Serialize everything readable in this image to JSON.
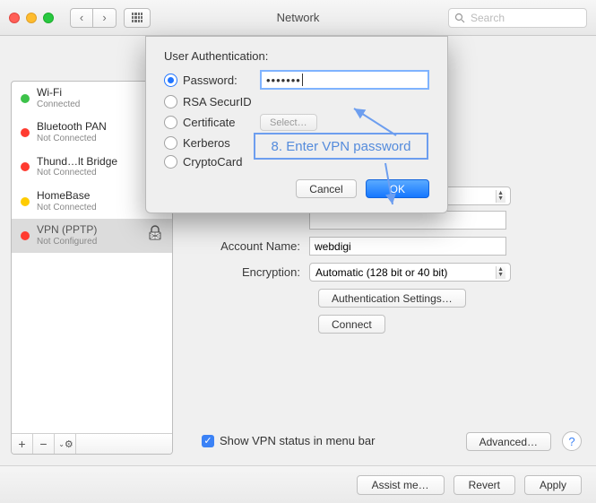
{
  "window": {
    "title": "Network",
    "search_placeholder": "Search"
  },
  "sidebar": {
    "items": [
      {
        "name": "Wi-Fi",
        "status": "Connected",
        "dot": "green"
      },
      {
        "name": "Bluetooth PAN",
        "status": "Not Connected",
        "dot": "red"
      },
      {
        "name": "Thund…lt Bridge",
        "status": "Not Connected",
        "dot": "red"
      },
      {
        "name": "HomeBase",
        "status": "Not Connected",
        "dot": "orange"
      },
      {
        "name": "VPN (PPTP)",
        "status": "Not Configured",
        "dot": "red"
      }
    ]
  },
  "form": {
    "account_name_label": "Account Name:",
    "account_name_value": "webdigi",
    "encryption_label": "Encryption:",
    "encryption_value": "Automatic (128 bit or 40 bit)",
    "auth_settings": "Authentication Settings…",
    "connect": "Connect",
    "show_vpn": "Show VPN status in menu bar",
    "advanced": "Advanced…"
  },
  "bottom": {
    "assist": "Assist me…",
    "revert": "Revert",
    "apply": "Apply"
  },
  "modal": {
    "title": "User Authentication:",
    "opts": {
      "password": "Password:",
      "rsa": "RSA SecurID",
      "cert": "Certificate",
      "kerberos": "Kerberos",
      "crypto": "CryptoCard"
    },
    "password_value": "•••••••",
    "select_label": "Select…",
    "cancel": "Cancel",
    "ok": "OK"
  },
  "annotation": {
    "text": "8. Enter VPN password"
  }
}
